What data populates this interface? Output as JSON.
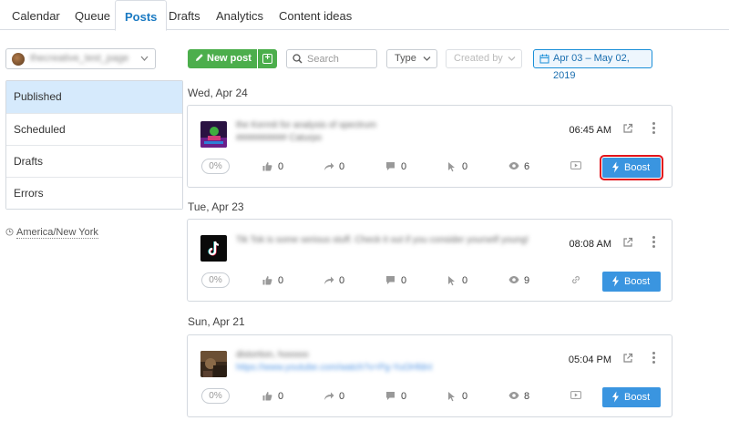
{
  "tabs": [
    {
      "label": "Calendar"
    },
    {
      "label": "Queue"
    },
    {
      "label": "Posts",
      "active": true
    },
    {
      "label": "Drafts"
    },
    {
      "label": "Analytics"
    },
    {
      "label": "Content ideas"
    }
  ],
  "sidebar": {
    "profile_name": "thecreative_test_page",
    "items": [
      {
        "label": "Published",
        "active": true
      },
      {
        "label": "Scheduled"
      },
      {
        "label": "Drafts"
      },
      {
        "label": "Errors"
      }
    ],
    "timezone": "America/New York"
  },
  "toolbar": {
    "new_post": "New post",
    "search_placeholder": "Search",
    "type_label": "Type",
    "created_by_label": "Created by",
    "date_range": "Apr 03 – May 02, 2019"
  },
  "posts": [
    {
      "day": "Wed, Apr 24",
      "text_line1": "the Kermit for analysis of spectrum",
      "text_line2": "########## Caturpo",
      "time": "06:45 AM",
      "engagement": "0%",
      "likes": "0",
      "shares": "0",
      "comments": "0",
      "clicks": "0",
      "views": "6",
      "tail_icon": "video-icon",
      "boost": "Boost",
      "boost_highlighted": true
    },
    {
      "day": "Tue, Apr 23",
      "text_line1": "Tik Tok is some serious stuff. Check it out if you consider yourself young!",
      "text_line2": "",
      "time": "08:08 AM",
      "engagement": "0%",
      "likes": "0",
      "shares": "0",
      "comments": "0",
      "clicks": "0",
      "views": "9",
      "tail_icon": "link-icon",
      "boost": "Boost",
      "boost_highlighted": false
    },
    {
      "day": "Sun, Apr 21",
      "text_line1": "distortion, hooooo",
      "text_line2": "https://www.youtube.com/watch?v=Pg-YuOHfdnI",
      "time": "05:04 PM",
      "engagement": "0%",
      "likes": "0",
      "shares": "0",
      "comments": "0",
      "clicks": "0",
      "views": "8",
      "tail_icon": "video-icon",
      "boost": "Boost",
      "boost_highlighted": false
    }
  ],
  "colors": {
    "accent": "#1b7ac2",
    "new_post_green": "#4cae4c",
    "boost_blue": "#3a95e0",
    "highlight_red": "#e3141b",
    "active_menu_bg": "#d6eafc"
  }
}
